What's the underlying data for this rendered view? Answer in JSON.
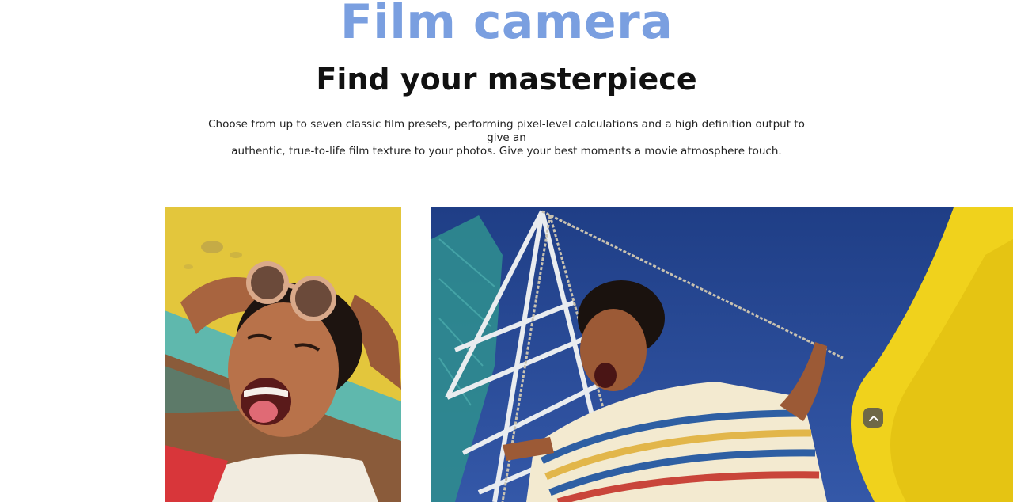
{
  "hero": {
    "eyebrow": "Film camera",
    "headline": "Find your masterpiece",
    "description_line1": "Choose from up to seven classic film presets, performing pixel-level calculations and a high definition output to give an",
    "description_line2": "authentic, true-to-life film texture to your photos. Give your best moments a movie atmosphere touch."
  },
  "gallery": {
    "left_photo_icon": "photo-portrait-sunglasses",
    "right_photo_icon": "photo-swing-ride"
  },
  "controls": {
    "scroll_top_icon": "chevron-up-icon"
  },
  "colors": {
    "accent_blue": "#7a9fe0",
    "heading": "#111111",
    "body_text": "#222222"
  }
}
